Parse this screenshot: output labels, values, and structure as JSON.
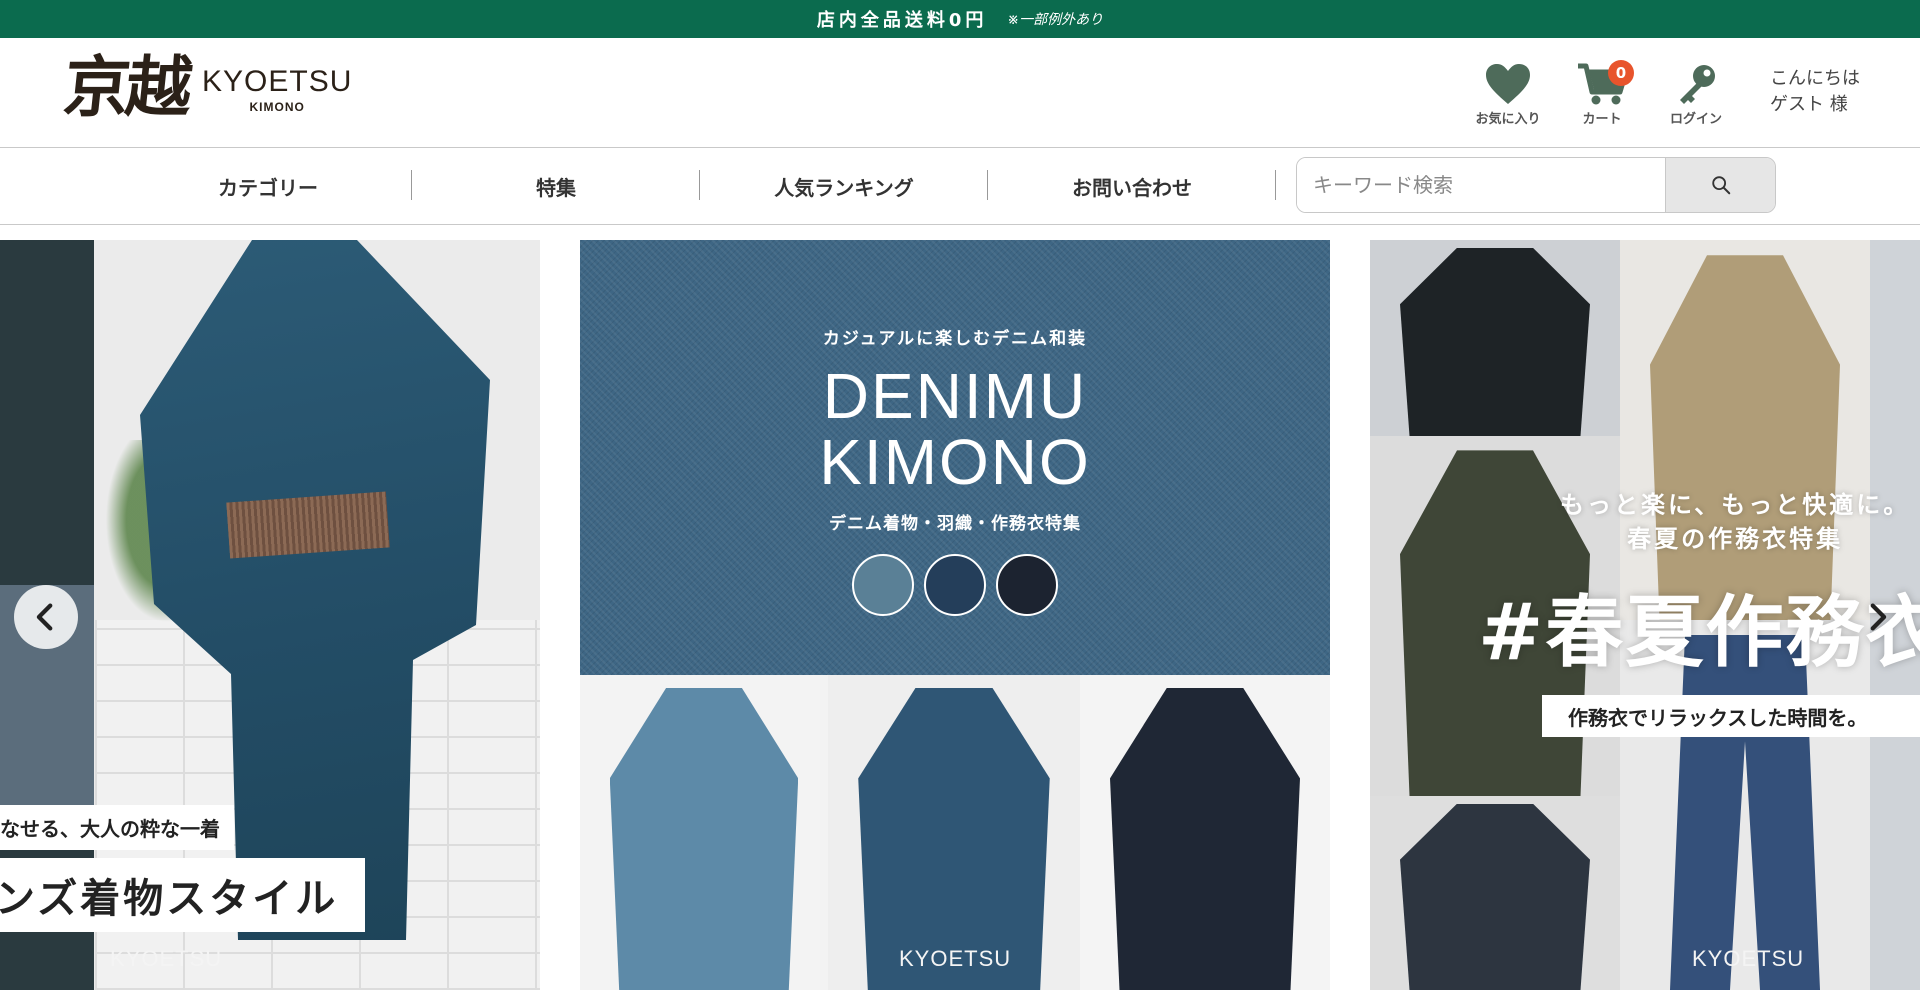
{
  "notice": {
    "main": "店内全品送料0円",
    "sub": "※一部例外あり"
  },
  "logo": {
    "kanji": "京越",
    "english": "KYOETSU",
    "sub": "KIMONO"
  },
  "header": {
    "favorites_label": "お気に入り",
    "cart_label": "カート",
    "cart_count": "0",
    "login_label": "ログイン",
    "greeting_line1": "こんにちは",
    "greeting_line2": "ゲスト 様"
  },
  "nav": {
    "items": [
      {
        "label": "カテゴリー"
      },
      {
        "label": "特集"
      },
      {
        "label": "人気ランキング"
      },
      {
        "label": "お問い合わせ"
      }
    ]
  },
  "search": {
    "placeholder": "キーワード検索",
    "icon": "search-icon"
  },
  "carousel": {
    "slide1": {
      "caption_small": "なせる、大人の粋な一着",
      "caption_large": "メンズ着物スタイル",
      "brand": "KYOETSU"
    },
    "slide2": {
      "kicker": "カジュアルに楽しむデニム和装",
      "title_line1": "DENIMU",
      "title_line2": "KIMONO",
      "subtitle": "デニム着物・羽織・作務衣特集",
      "brand": "KYOETSU",
      "swatch_colors": [
        "#5a8096",
        "#243e5a",
        "#1c2330"
      ]
    },
    "slide3": {
      "subtitle_line1": "もっと楽に、もっと快適に。",
      "subtitle_line2": "春夏の作務衣特集",
      "headline": "#春夏作務衣",
      "band": "作務衣でリラックスした時間を。",
      "brand": "KYOETSU"
    }
  },
  "colors": {
    "notice_bg": "#0b6b4e",
    "icon_green": "#4e6b5a",
    "badge": "#e8542c"
  }
}
